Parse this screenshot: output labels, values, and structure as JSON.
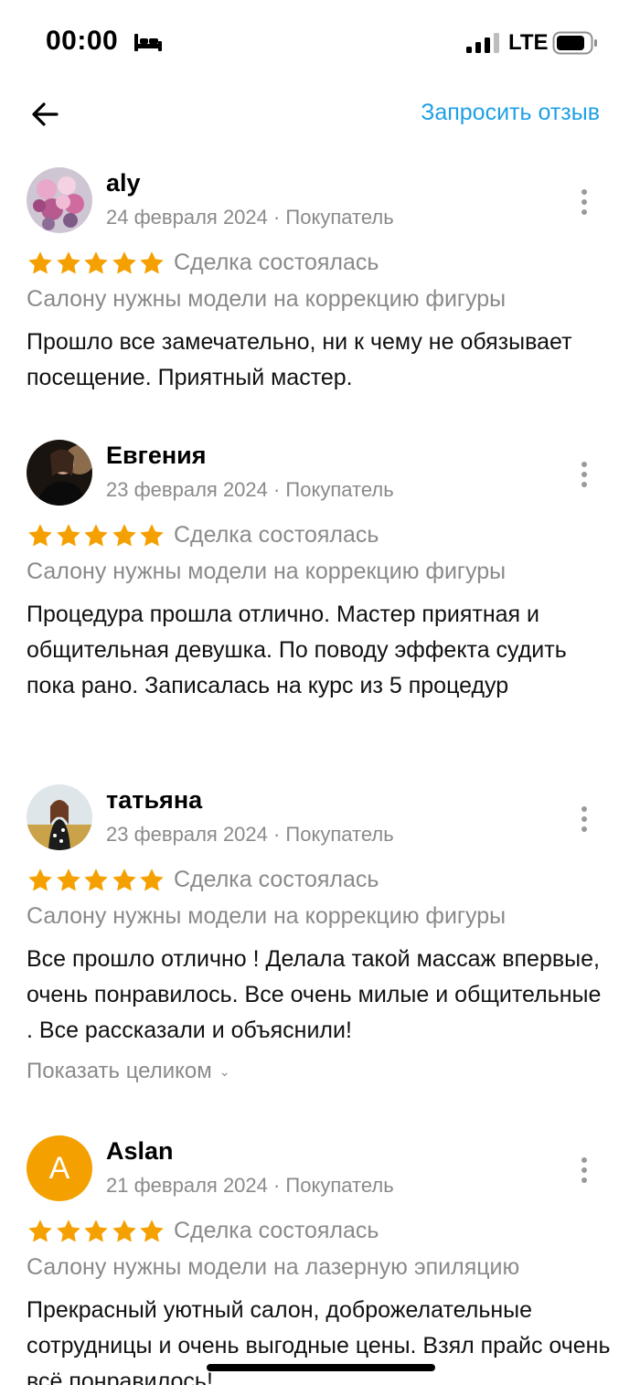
{
  "status_bar": {
    "time": "00:00",
    "network": "LTE"
  },
  "header": {
    "request_review_label": "Запросить отзыв"
  },
  "colors": {
    "accent_link": "#1ea0e6",
    "star": "#f4a000",
    "secondary_text": "#8a8a8a"
  },
  "reviews": [
    {
      "author": "aly",
      "meta": "24 февраля 2024 · Покупатель",
      "rating": 5,
      "deal_status": "Сделка состоялась",
      "ad_title": "Салону нужны модели на коррекцию фигуры",
      "text": "Прошло все замечательно, ни к чему не обязывает посещение. Приятный мастер."
    },
    {
      "author": "Евгения",
      "meta": "23 февраля 2024 · Покупатель",
      "rating": 5,
      "deal_status": "Сделка состоялась",
      "ad_title": "Салону нужны модели на коррекцию фигуры",
      "text": "Процедура прошла отлично. Мастер приятная и общительная девушка. По поводу эффекта судить пока рано. Записалась на курс из 5 процедур"
    },
    {
      "author": "татьяна",
      "meta": "23 февраля 2024 · Покупатель",
      "rating": 5,
      "deal_status": "Сделка состоялась",
      "ad_title": "Салону нужны модели на коррекцию фигуры",
      "text": "Все прошло отлично ! Делала такой массаж впервые, очень понравилось. Все очень милые и общительные . Все рассказали и объяснили!",
      "show_more_label": "Показать целиком"
    },
    {
      "author": "Aslan",
      "avatar_letter": "A",
      "meta": "21 февраля 2024 · Покупатель",
      "rating": 5,
      "deal_status": "Сделка состоялась",
      "ad_title": "Салону нужны модели на лазерную эпиляцию",
      "text": "Прекрасный уютный салон, доброжелательные сотрудницы и очень выгодные цены. Взял прайс очень всё понравилось!"
    }
  ]
}
